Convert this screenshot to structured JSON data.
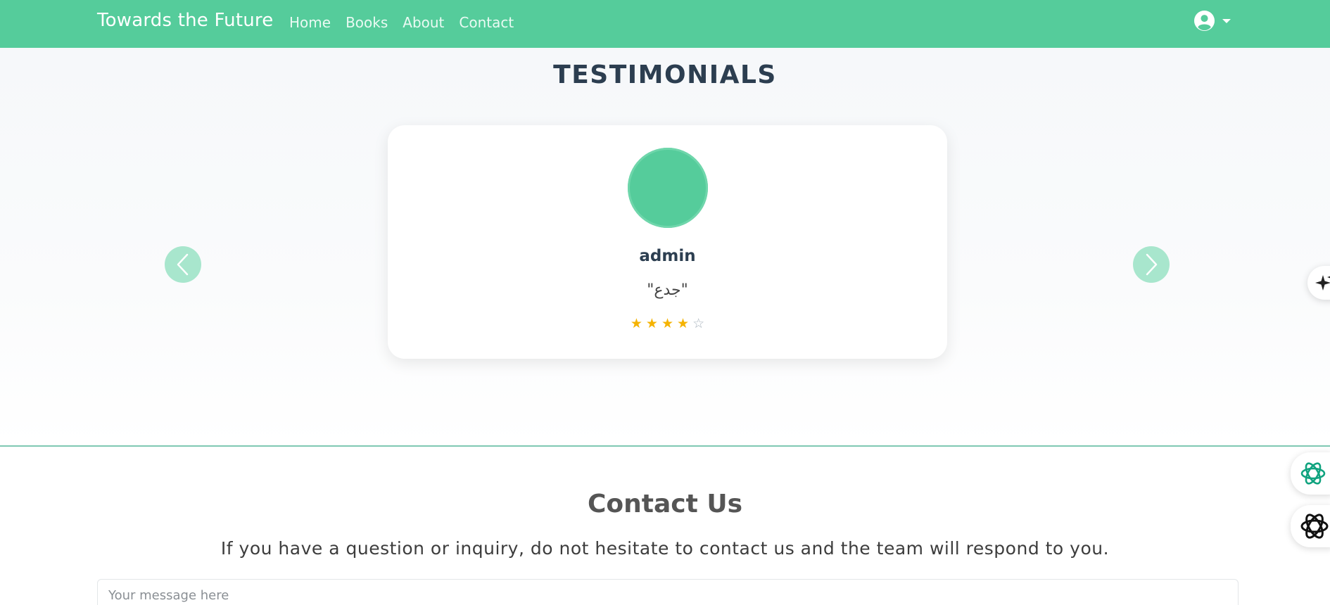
{
  "navbar": {
    "brand": "Towards the Future",
    "links": [
      "Home",
      "Books",
      "About",
      "Contact"
    ],
    "user_icon": "user-circle-icon",
    "caret_icon": "caret-down-icon"
  },
  "testimonials": {
    "title": "TESTIMONIALS",
    "card": {
      "name": "admin",
      "quote": "\"جدع\"",
      "rating": 4,
      "max_rating": 5
    },
    "prev_icon": "chevron-left-icon",
    "next_icon": "chevron-right-icon"
  },
  "contact": {
    "title": "Contact Us",
    "subtitle": "If you have a question or inquiry, do not hesitate to contact us and the team will respond to you.",
    "message_placeholder": "Your message here"
  },
  "side_widgets": [
    "sparkle-icon",
    "openai-icon",
    "openai-dark-icon"
  ],
  "colors": {
    "accent": "#55cc9b",
    "star": "#f5b301",
    "title": "#2c3e50"
  }
}
